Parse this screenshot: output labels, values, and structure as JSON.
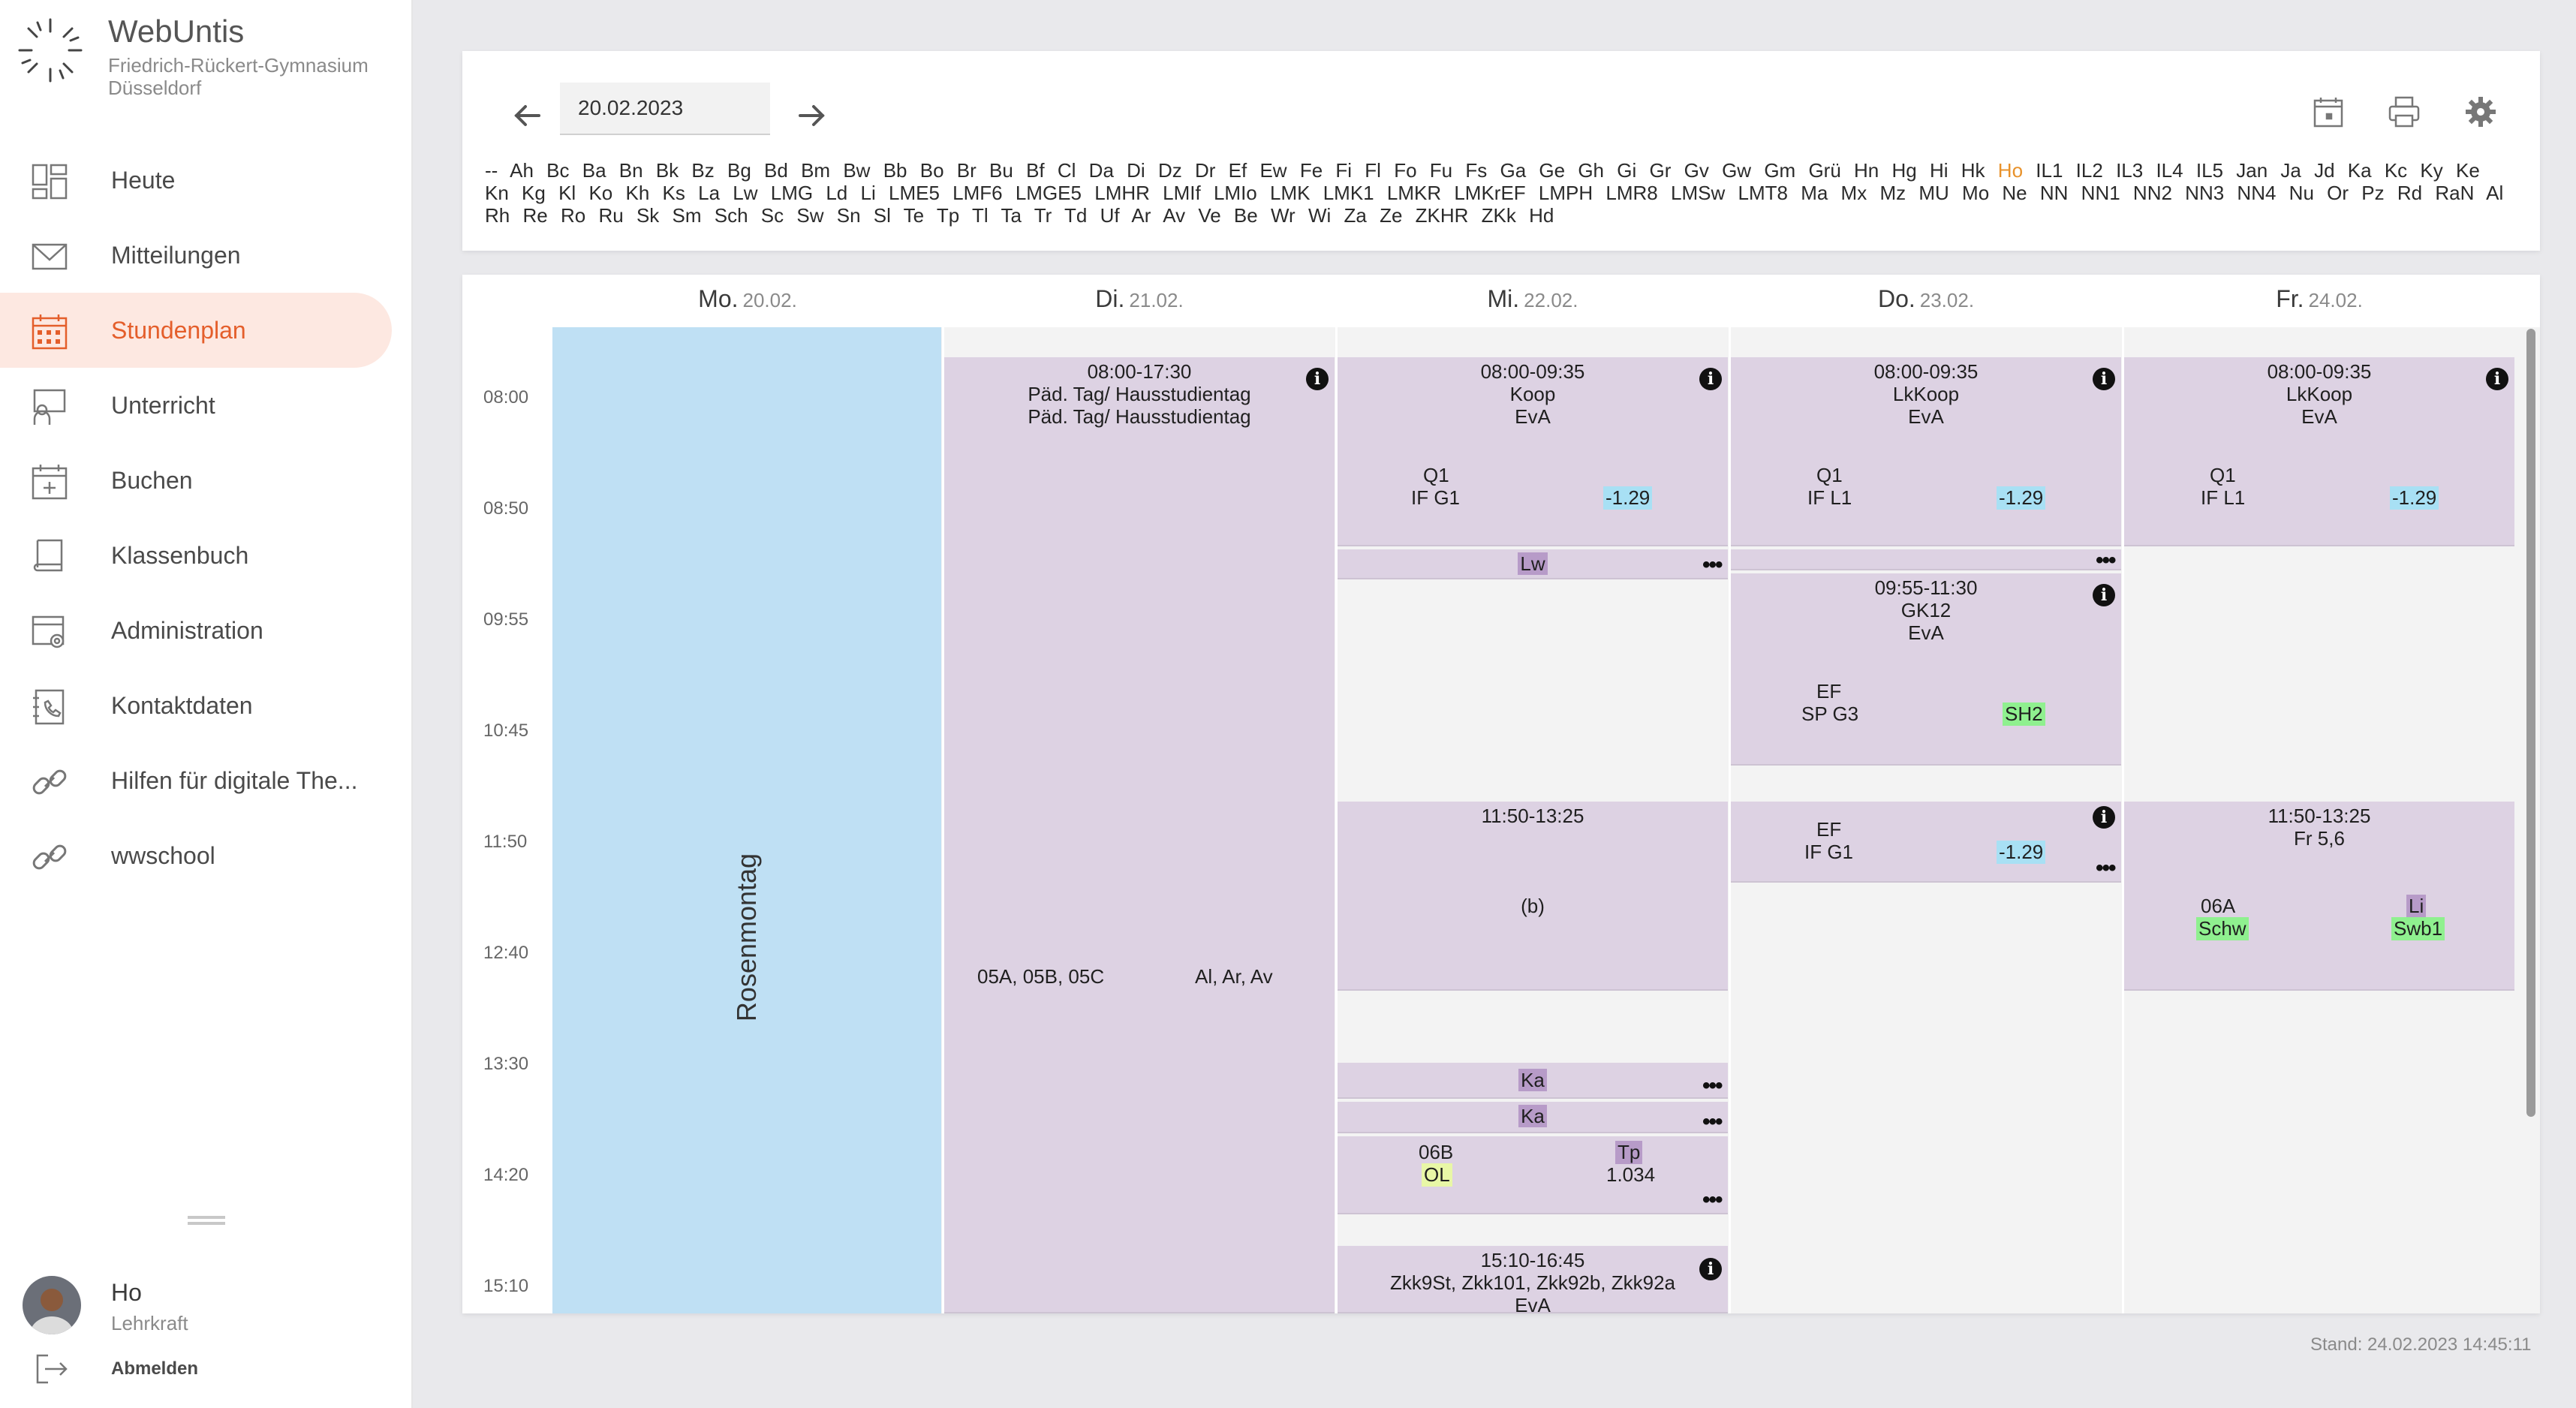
{
  "app": {
    "name": "WebUntis",
    "school_line1": "Friedrich-Rückert-Gymnasium",
    "school_line2": "Düsseldorf"
  },
  "nav": {
    "items": [
      {
        "label": "Heute",
        "icon": "dashboard-icon"
      },
      {
        "label": "Mitteilungen",
        "icon": "mail-icon"
      },
      {
        "label": "Stundenplan",
        "icon": "calendar-icon",
        "active": true
      },
      {
        "label": "Unterricht",
        "icon": "teacher-icon"
      },
      {
        "label": "Buchen",
        "icon": "calendar-plus-icon"
      },
      {
        "label": "Klassenbuch",
        "icon": "book-icon"
      },
      {
        "label": "Administration",
        "icon": "admin-gear-icon"
      },
      {
        "label": "Kontaktdaten",
        "icon": "contact-book-icon"
      },
      {
        "label": "Hilfen für digitale The...",
        "icon": "link-icon"
      },
      {
        "label": "wwschool",
        "icon": "link-icon"
      }
    ]
  },
  "user": {
    "name": "Ho",
    "role": "Lehrkraft",
    "logout_label": "Abmelden"
  },
  "toolbar": {
    "date_value": "20.02.2023",
    "selected_teacher": "Ho",
    "teachers": [
      "--",
      "Ah",
      "Bc",
      "Ba",
      "Bn",
      "Bk",
      "Bz",
      "Bg",
      "Bd",
      "Bm",
      "Bw",
      "Bb",
      "Bo",
      "Br",
      "Bu",
      "Bf",
      "Cl",
      "Da",
      "Di",
      "Dz",
      "Dr",
      "Ef",
      "Ew",
      "Fe",
      "Fi",
      "Fl",
      "Fo",
      "Fu",
      "Fs",
      "Ga",
      "Ge",
      "Gh",
      "Gi",
      "Gr",
      "Gv",
      "Gw",
      "Gm",
      "Grü",
      "Hn",
      "Hg",
      "Hi",
      "Hk",
      "Ho",
      "IL1",
      "IL2",
      "IL3",
      "IL4",
      "IL5",
      "Jan",
      "Ja",
      "Jd",
      "Ka",
      "Kc",
      "Ky",
      "Ke",
      "Kn",
      "Kg",
      "Kl",
      "Ko",
      "Kh",
      "Ks",
      "La",
      "Lw",
      "LMG",
      "Ld",
      "Li",
      "LME5",
      "LMF6",
      "LMGE5",
      "LMHR",
      "LMIf",
      "LMIo",
      "LMK",
      "LMK1",
      "LMKR",
      "LMKrEF",
      "LMPH",
      "LMR8",
      "LMSw",
      "LMT8",
      "Ma",
      "Mx",
      "Mz",
      "MU",
      "Mo",
      "Ne",
      "NN",
      "NN1",
      "NN2",
      "NN3",
      "NN4",
      "Nu",
      "Or",
      "Pz",
      "Rd",
      "RaN",
      "Al",
      "Rh",
      "Re",
      "Ro",
      "Ru",
      "Sk",
      "Sm",
      "Sch",
      "Sc",
      "Sw",
      "Sn",
      "Sl",
      "Te",
      "Tp",
      "Tl",
      "Ta",
      "Tr",
      "Td",
      "Uf",
      "Ar",
      "Av",
      "Ve",
      "Be",
      "Wr",
      "Wi",
      "Za",
      "Ze",
      "ZKHR",
      "ZKk",
      "Hd"
    ]
  },
  "timetable": {
    "days": [
      {
        "name": "Mo.",
        "date": "20.02."
      },
      {
        "name": "Di.",
        "date": "21.02."
      },
      {
        "name": "Mi.",
        "date": "22.02."
      },
      {
        "name": "Do.",
        "date": "23.02."
      },
      {
        "name": "Fr.",
        "date": "24.02."
      }
    ],
    "times": [
      "08:00",
      "08:50",
      "09:55",
      "10:45",
      "11:50",
      "12:40",
      "13:30",
      "14:20",
      "15:10"
    ],
    "monday_holiday": "Rosenmontag",
    "tue": {
      "time": "08:00-17:30",
      "line1": "Päd. Tag/ Hausstudientag",
      "line2": "Päd. Tag/ Hausstudientag",
      "classes": "05A, 05B, 05C",
      "teachers": "Al, Ar, Av"
    },
    "wed": {
      "l1_time": "08:00-09:35",
      "l1_subject": "Koop",
      "l1_note": "EvA",
      "l1_class": "Q1",
      "l1_group": "IF G1",
      "l1_room": "-1.29",
      "l2_teacher": "Lw",
      "l3_time": "11:50-13:25",
      "l3_note": "(b)",
      "l4_teacher": "Ka",
      "l5_teacher": "Ka",
      "l6_class": "06B",
      "l6_subject": "OL",
      "l6_teacher": "Tp",
      "l6_room": "1.034",
      "l7_time": "15:10-16:45",
      "l7_groups": "Zkk9St, Zkk101, Zkk92b, Zkk92a",
      "l7_note": "EvA"
    },
    "thu": {
      "l1_time": "08:00-09:35",
      "l1_subject": "LkKoop",
      "l1_note": "EvA",
      "l1_class": "Q1",
      "l1_group": "IF L1",
      "l1_room": "-1.29",
      "l2_time": "09:55-11:30",
      "l2_subject": "GK12",
      "l2_note": "EvA",
      "l2_class": "EF",
      "l2_group": "SP G3",
      "l2_room": "SH2",
      "l3_class": "EF",
      "l3_group": "IF G1",
      "l3_room": "-1.29"
    },
    "fri": {
      "l1_time": "08:00-09:35",
      "l1_subject": "LkKoop",
      "l1_note": "EvA",
      "l1_class": "Q1",
      "l1_group": "IF L1",
      "l1_room": "-1.29",
      "l2_time": "11:50-13:25",
      "l2_subject": "Fr 5,6",
      "l2_class": "06A",
      "l2_teacher": "Li",
      "l2_label": "Schw",
      "l2_room": "Swb1"
    }
  },
  "footer": {
    "stand": "Stand: 24.02.2023 14:45:11"
  },
  "colors": {
    "accent": "#e45e2b",
    "lesson": "#ddd2e3",
    "holiday": "#bfe0f4",
    "room_highlight": "#a8e0f4",
    "substitution_highlight": "#8ff08f"
  }
}
